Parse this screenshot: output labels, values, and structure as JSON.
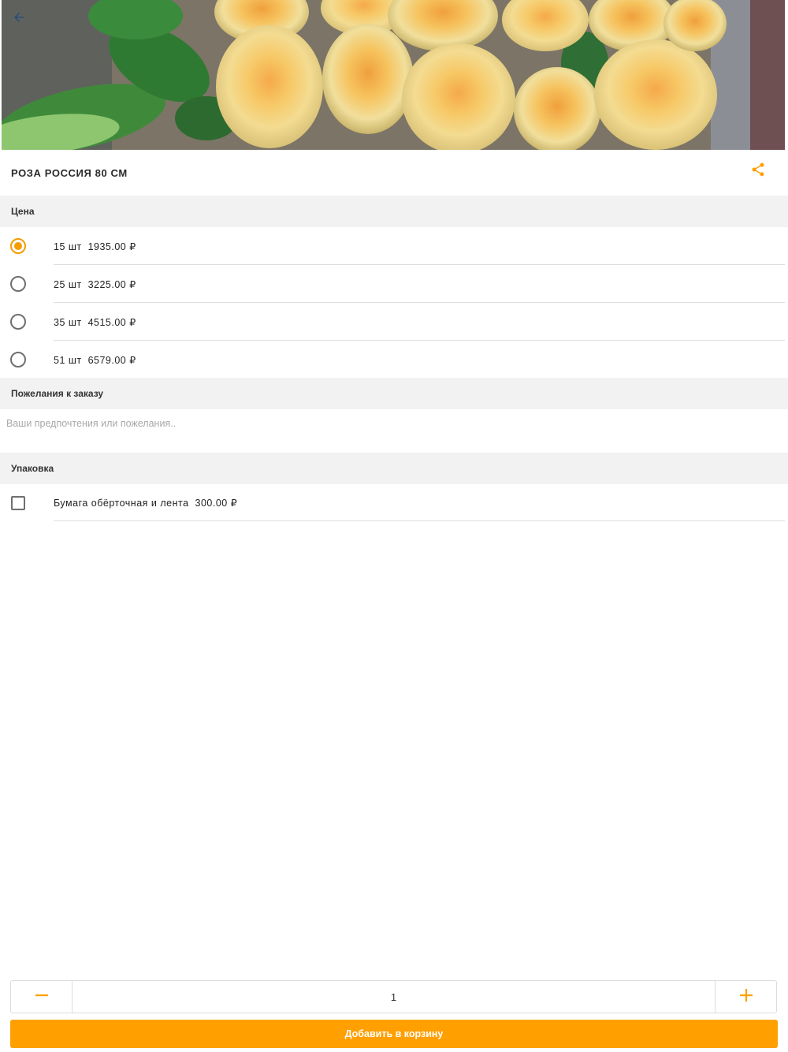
{
  "product": {
    "title": "РОЗА РОССИЯ 80 СМ",
    "image": "bouquet of yellow-peach roses"
  },
  "price_section": {
    "header": "Цена",
    "selected_index": 0,
    "options": [
      {
        "label": "15 шт  1935.00 ₽"
      },
      {
        "label": "25 шт  3225.00 ₽"
      },
      {
        "label": "35 шт  4515.00 ₽"
      },
      {
        "label": "51 шт  6579.00 ₽"
      }
    ]
  },
  "wishes_section": {
    "header": "Пожелания к заказу",
    "placeholder": "Ваши предпочтения или пожелания..",
    "value": ""
  },
  "packaging_section": {
    "header": "Упаковка",
    "options": [
      {
        "label": "Бумага обёрточная и лента  300.00 ₽",
        "checked": false
      }
    ]
  },
  "cart": {
    "quantity": "1",
    "add_label": "Добавить в корзину"
  },
  "icons": {
    "back": "arrow-left-icon",
    "share": "share-icon",
    "minus": "minus-icon",
    "plus": "plus-icon"
  },
  "colors": {
    "accent": "#ff9f00",
    "section_bg": "#f2f2f2",
    "divider": "#dedede",
    "back_arrow": "#2b4a7a"
  }
}
